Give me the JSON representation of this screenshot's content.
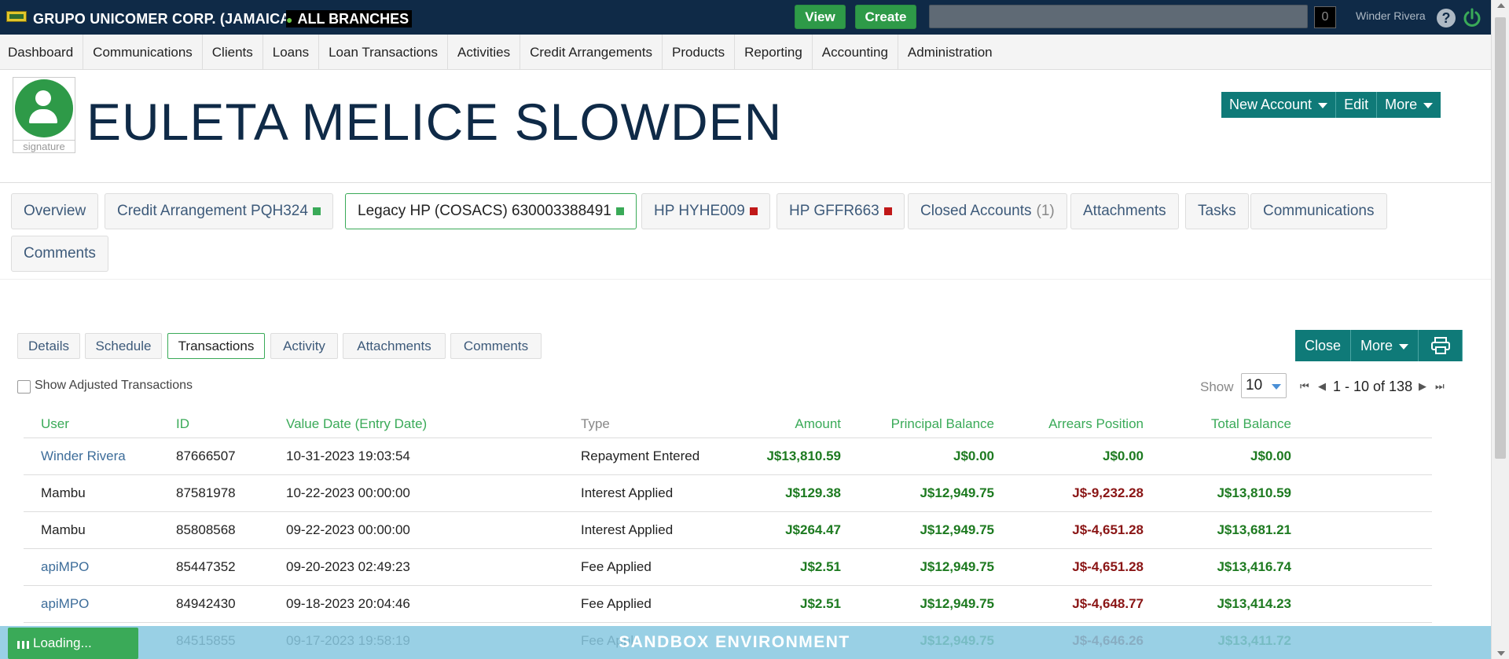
{
  "topbar": {
    "org": "GRUPO UNICOMER CORP. (JAMAICA)",
    "branch": "ALL BRANCHES",
    "view_label": "View",
    "create_label": "Create",
    "counter": "0",
    "user": "Winder Rivera",
    "help": "?"
  },
  "nav": [
    "Dashboard",
    "Communications",
    "Clients",
    "Loans",
    "Loan Transactions",
    "Activities",
    "Credit Arrangements",
    "Products",
    "Reporting",
    "Accounting",
    "Administration"
  ],
  "client": {
    "name": "EULETA MELICE SLOWDEN",
    "signature_label": "signature",
    "new_account_label": "New Account",
    "edit_label": "Edit",
    "more_label": "More"
  },
  "account_tabs": [
    {
      "label": "Overview"
    },
    {
      "label": "Credit Arrangement PQH324",
      "status": "green"
    },
    {
      "label": "Legacy HP (COSACS) 630003388491",
      "status": "green",
      "active": true
    },
    {
      "label": "HP HYHE009",
      "status": "red"
    },
    {
      "label": "HP GFFR663",
      "status": "red"
    },
    {
      "label": "Closed Accounts",
      "count": "(1)"
    },
    {
      "label": "Attachments"
    },
    {
      "label": "Tasks"
    },
    {
      "label": "Communications"
    },
    {
      "label": "Comments"
    }
  ],
  "sub_tabs": [
    "Details",
    "Schedule",
    "Transactions",
    "Activity",
    "Attachments",
    "Comments"
  ],
  "active_sub_tab": "Transactions",
  "loan_actions": {
    "close_label": "Close",
    "more_label": "More"
  },
  "filters": {
    "show_adjusted_label": "Show Adjusted Transactions",
    "show_label": "Show",
    "page_size": "10",
    "pager_text": "1 - 10 of 138"
  },
  "table": {
    "headers": [
      "User",
      "ID",
      "Value Date (Entry Date)",
      "Type",
      "Amount",
      "Principal Balance",
      "Arrears Position",
      "Total Balance"
    ],
    "rows": [
      {
        "user": "Winder Rivera",
        "user_link": true,
        "id": "87666507",
        "date": "10-31-2023 19:03:54",
        "type": "Repayment Entered",
        "amount": "J$13,810.59",
        "principal": "J$0.00",
        "arrears": "J$0.00",
        "arrears_neg": false,
        "total": "J$0.00"
      },
      {
        "user": "Mambu",
        "user_link": false,
        "id": "87581978",
        "date": "10-22-2023 00:00:00",
        "type": "Interest Applied",
        "amount": "J$129.38",
        "principal": "J$12,949.75",
        "arrears": "J$-9,232.28",
        "arrears_neg": true,
        "total": "J$13,810.59"
      },
      {
        "user": "Mambu",
        "user_link": false,
        "id": "85808568",
        "date": "09-22-2023 00:00:00",
        "type": "Interest Applied",
        "amount": "J$264.47",
        "principal": "J$12,949.75",
        "arrears": "J$-4,651.28",
        "arrears_neg": true,
        "total": "J$13,681.21"
      },
      {
        "user": "apiMPO",
        "user_link": true,
        "id": "85447352",
        "date": "09-20-2023 02:49:23",
        "type": "Fee Applied",
        "amount": "J$2.51",
        "principal": "J$12,949.75",
        "arrears": "J$-4,651.28",
        "arrears_neg": true,
        "total": "J$13,416.74"
      },
      {
        "user": "apiMPO",
        "user_link": true,
        "id": "84942430",
        "date": "09-18-2023 20:04:46",
        "type": "Fee Applied",
        "amount": "J$2.51",
        "principal": "J$12,949.75",
        "arrears": "J$-4,648.77",
        "arrears_neg": true,
        "total": "J$13,414.23"
      },
      {
        "user": "",
        "user_link": false,
        "id": "84515855",
        "date": "09-17-2023 19:58:19",
        "type": "Fee Appl",
        "amount": "",
        "principal": "J$12,949.75",
        "arrears": "J$-4,646.26",
        "arrears_neg": true,
        "total": "J$13,411.72"
      }
    ]
  },
  "footer": {
    "sandbox_label": "SANDBOX ENVIRONMENT",
    "loading_label": "Loading..."
  },
  "colors": {
    "topbar": "#0f2a47",
    "accent_green": "#3aaa58",
    "action_teal": "#0f7a78",
    "negative": "#8a1515",
    "positive": "#1d7a20"
  },
  "icons": [
    "logo-icon",
    "help-icon",
    "power-icon",
    "caret-down-icon",
    "print-icon",
    "first-page-icon",
    "prev-page-icon",
    "next-page-icon",
    "last-page-icon"
  ]
}
